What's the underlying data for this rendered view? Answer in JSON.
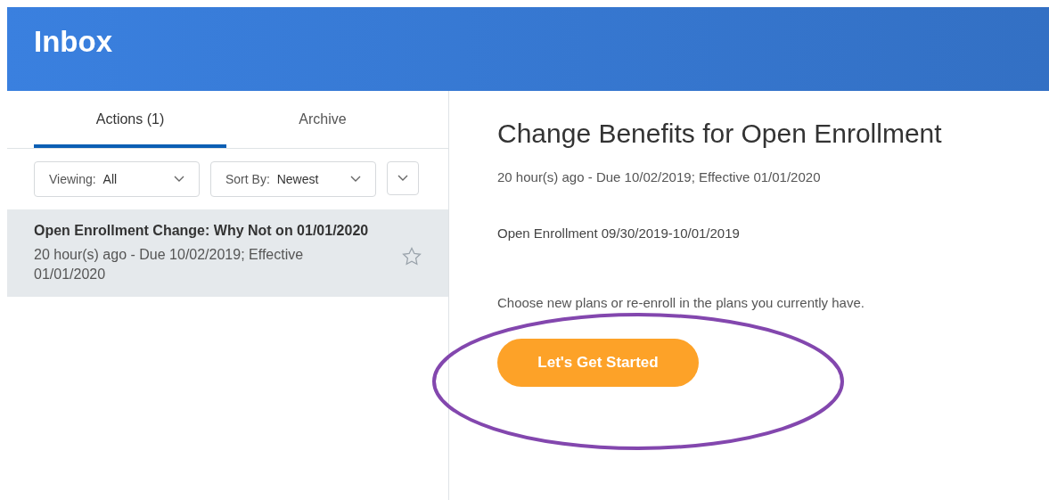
{
  "header": {
    "title": "Inbox"
  },
  "tabs": [
    {
      "label": "Actions (1)",
      "selected": true
    },
    {
      "label": "Archive",
      "selected": false
    }
  ],
  "filters": [
    {
      "label": "Viewing:",
      "value": "All"
    },
    {
      "label": "Sort By:",
      "value": "Newest"
    }
  ],
  "inbox_items": [
    {
      "title": "Open Enrollment Change: Why Not on 01/01/2020",
      "subtitle": "20 hour(s) ago - Due 10/02/2019; Effective 01/01/2020",
      "selected": true,
      "starred": false
    }
  ],
  "detail": {
    "title": "Change Benefits for Open Enrollment",
    "meta": "20 hour(s) ago - Due 10/02/2019; Effective 01/01/2020",
    "period": "Open Enrollment 09/30/2019-10/01/2019",
    "description": "Choose new plans or re-enroll in the plans you currently have.",
    "button": "Let's Get Started"
  }
}
